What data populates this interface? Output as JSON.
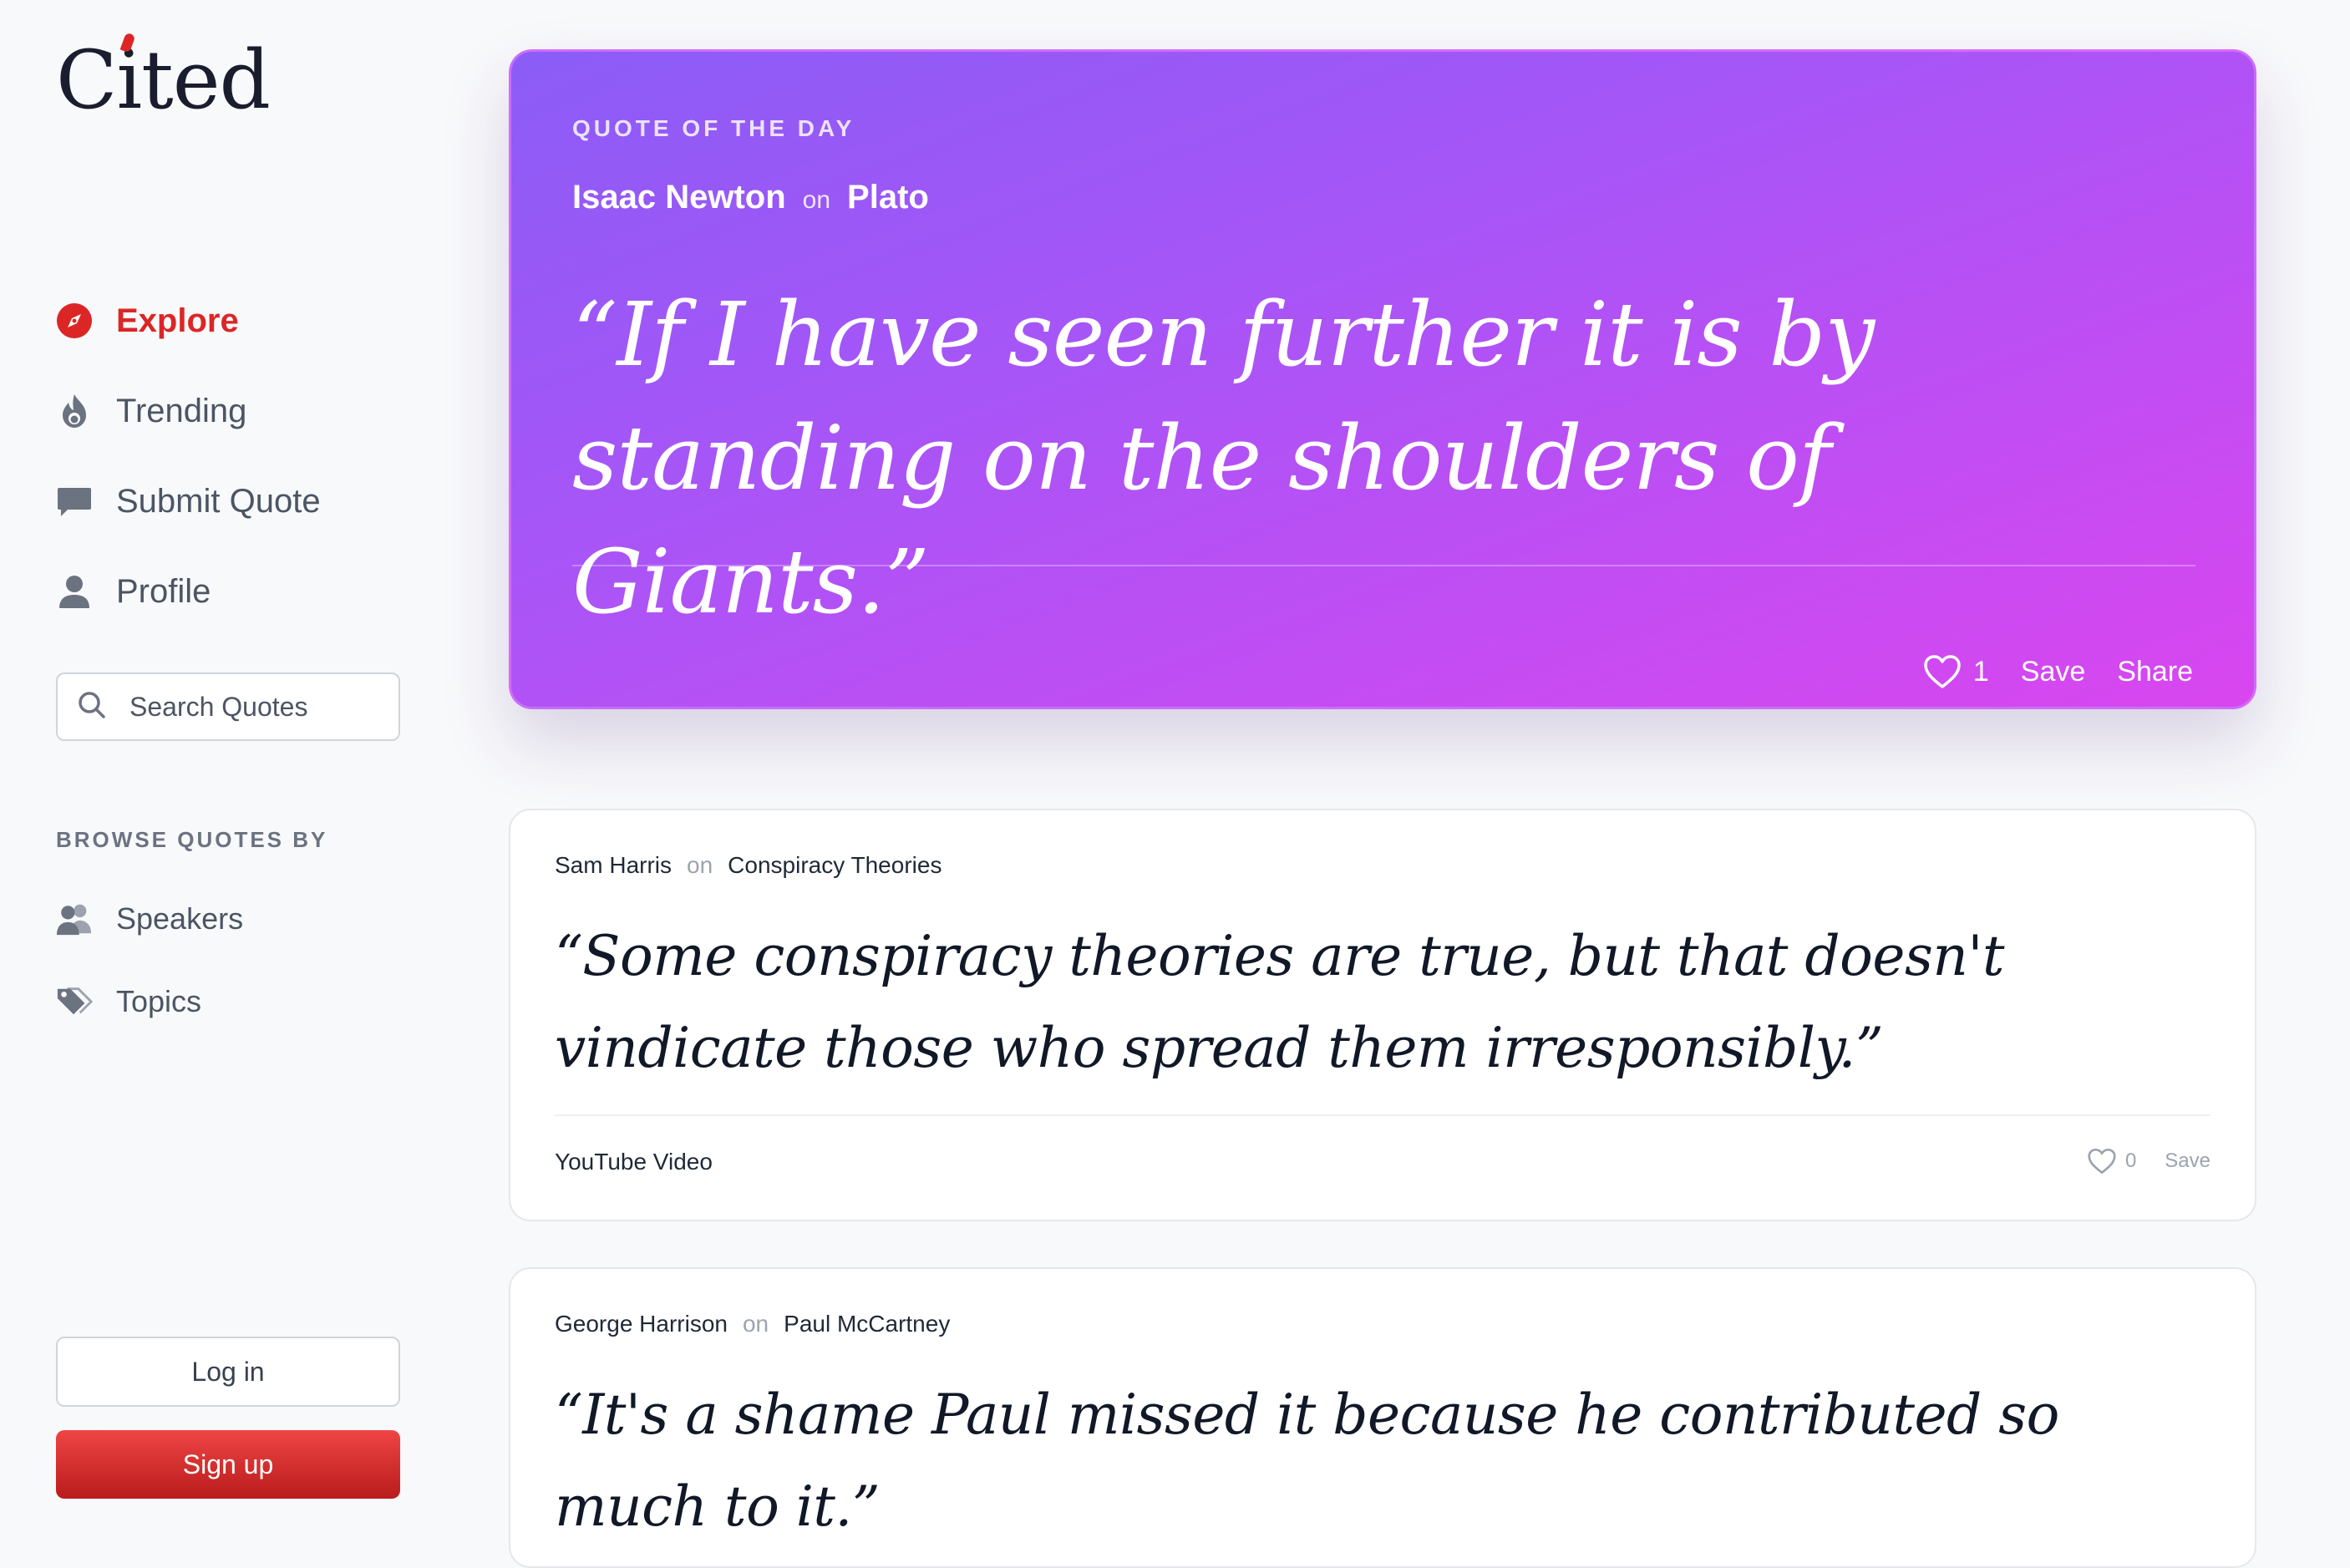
{
  "brand": {
    "name": "Cited",
    "accent_color": "#dc2626"
  },
  "nav": {
    "items": [
      {
        "label": "Explore",
        "icon": "compass-icon",
        "active": true
      },
      {
        "label": "Trending",
        "icon": "flame-icon",
        "active": false
      },
      {
        "label": "Submit Quote",
        "icon": "speech-bubble-icon",
        "active": false
      },
      {
        "label": "Profile",
        "icon": "user-icon",
        "active": false
      }
    ]
  },
  "search": {
    "placeholder": "Search Quotes",
    "value": ""
  },
  "browse": {
    "heading": "BROWSE QUOTES BY",
    "items": [
      {
        "label": "Speakers",
        "icon": "users-icon"
      },
      {
        "label": "Topics",
        "icon": "tags-icon"
      }
    ]
  },
  "auth": {
    "login_label": "Log in",
    "signup_label": "Sign up"
  },
  "quote_of_the_day": {
    "label": "QUOTE OF THE DAY",
    "speaker": "Isaac Newton",
    "on_word": "on",
    "topic": "Plato",
    "text": "“If I have seen further it is by standing on the shoulders of Giants.”",
    "likes": "1",
    "save_label": "Save",
    "share_label": "Share"
  },
  "quotes": [
    {
      "speaker": "Sam Harris",
      "on_word": "on",
      "topic": "Conspiracy Theories",
      "text": "“Some conspiracy theories are true, but that doesn't vindicate those who spread them irresponsibly.”",
      "source": "YouTube Video",
      "likes": "0",
      "save_label": "Save"
    },
    {
      "speaker": "George Harrison",
      "on_word": "on",
      "topic": "Paul McCartney",
      "text": "“It's a shame Paul missed it because he contributed so much to it.”"
    }
  ]
}
